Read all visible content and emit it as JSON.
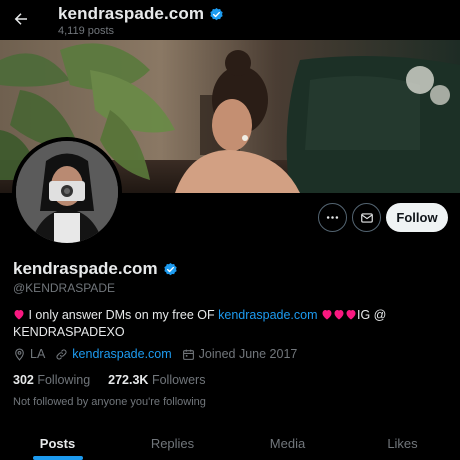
{
  "header": {
    "title": "kendraspade.com",
    "post_count": "4,119 posts",
    "back_icon": "arrow-left-icon",
    "verified_icon": "verified-badge-icon"
  },
  "profile": {
    "display_name": "kendraspade.com",
    "handle": "@KENDRASPADE",
    "bio": {
      "text_1": "I only answer DMs on my free OF",
      "link": "kendraspade.com",
      "text_2": "IG @",
      "text_3": "KENDRASPADEXO"
    },
    "location": "LA",
    "website": "kendraspade.com",
    "joined": "Joined June 2017",
    "following_count": "302",
    "following_label": "Following",
    "followers_count": "272.3K",
    "followers_label": "Followers",
    "followed_note": "Not followed by anyone you're following"
  },
  "actions": {
    "more_icon": "more-horizontal-icon",
    "message_icon": "envelope-icon",
    "follow_label": "Follow"
  },
  "tabs": [
    {
      "label": "Posts",
      "active": true
    },
    {
      "label": "Replies",
      "active": false
    },
    {
      "label": "Media",
      "active": false
    },
    {
      "label": "Likes",
      "active": false
    }
  ],
  "colors": {
    "background": "#000000",
    "accent": "#1d9bf0",
    "text_primary": "#e7e9ea",
    "text_secondary": "#71767b",
    "follow_button": "#eff3f4",
    "heart": "#f91880"
  }
}
